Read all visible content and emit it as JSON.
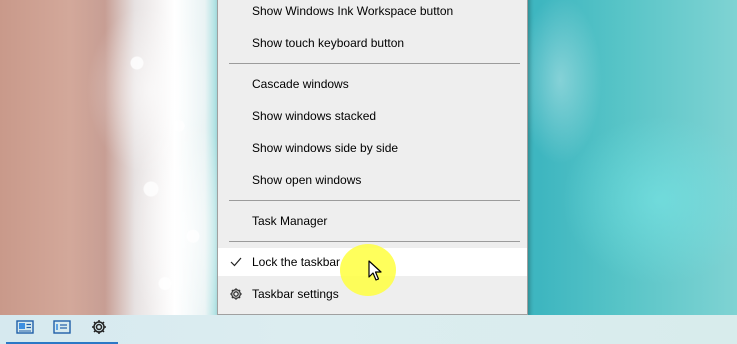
{
  "context_menu": {
    "items": [
      {
        "label": "Show Windows Ink Workspace button"
      },
      {
        "label": "Show touch keyboard button"
      },
      {
        "label": "Cascade windows"
      },
      {
        "label": "Show windows stacked"
      },
      {
        "label": "Show windows side by side"
      },
      {
        "label": "Show open windows"
      },
      {
        "label": "Task Manager"
      },
      {
        "label": "Lock the taskbar",
        "checked": true,
        "icon": "check-icon"
      },
      {
        "label": "Taskbar settings",
        "icon": "gear-icon"
      }
    ]
  },
  "taskbar": {
    "buttons": [
      {
        "icon": "people-contact-icon"
      },
      {
        "icon": "windows-ink-icon"
      },
      {
        "icon": "gear-icon"
      }
    ]
  },
  "colors": {
    "menu_background": "#eeeeee",
    "menu_hover": "#ffffff",
    "cursor_highlight": "#ffff40",
    "taskbar_accent": "#2b78c6"
  }
}
